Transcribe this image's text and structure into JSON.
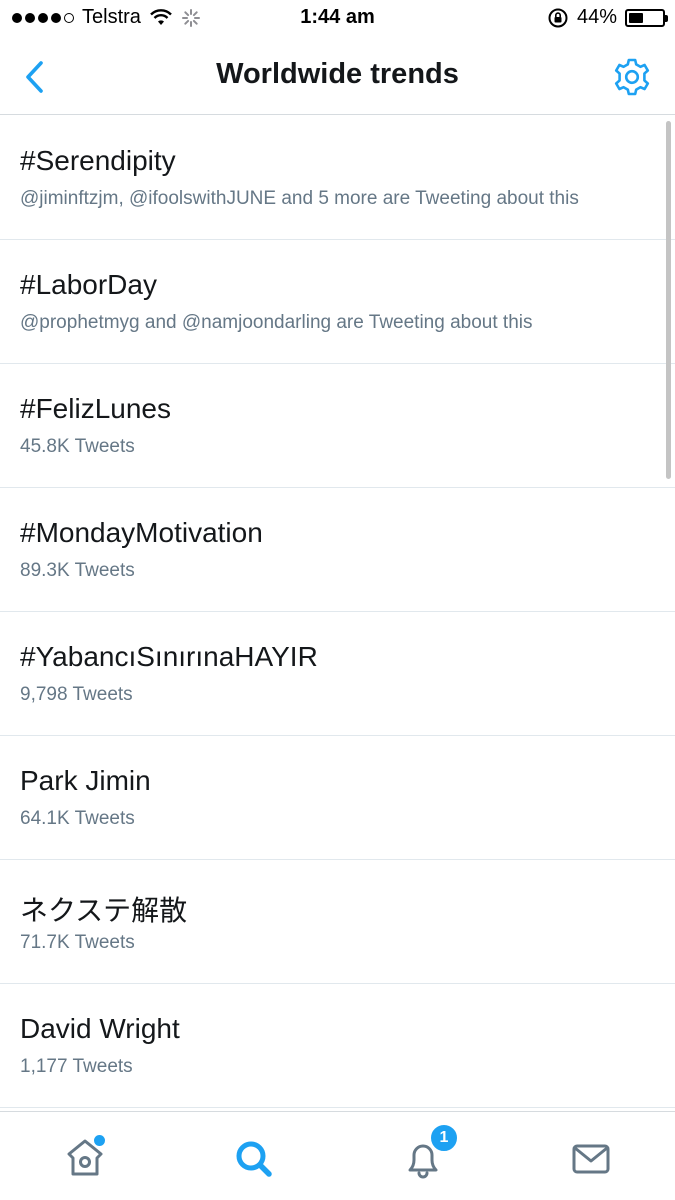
{
  "status_bar": {
    "carrier": "Telstra",
    "time": "1:44 am",
    "battery_percent": "44%",
    "battery_level": 0.44,
    "signal_dots_filled": 4,
    "signal_dots_total": 5
  },
  "nav": {
    "title": "Worldwide trends",
    "back_icon": "chevron-left-icon",
    "settings_icon": "gear-icon"
  },
  "trends": [
    {
      "name": "#Serendipity",
      "meta": "@jiminftzjm, @ifoolswithJUNE and 5 more are Tweeting about this"
    },
    {
      "name": "#LaborDay",
      "meta": "@prophetmyg and @namjoondarling are Tweeting about this"
    },
    {
      "name": "#FelizLunes",
      "meta": "45.8K Tweets"
    },
    {
      "name": "#MondayMotivation",
      "meta": "89.3K Tweets"
    },
    {
      "name": "#YabancıSınırınaHAYIR",
      "meta": "9,798 Tweets"
    },
    {
      "name": "Park Jimin",
      "meta": "64.1K Tweets"
    },
    {
      "name": "ネクステ解散",
      "meta": "71.7K Tweets"
    },
    {
      "name": "David Wright",
      "meta": "1,177 Tweets"
    }
  ],
  "tab_bar": {
    "tabs": [
      "home-icon",
      "search-icon",
      "notifications-icon",
      "messages-icon"
    ],
    "active_tab": "search-icon",
    "notification_count": "1"
  },
  "colors": {
    "accent": "#1da1f2",
    "primary_text": "#14171a",
    "secondary_text": "#657786",
    "icon_gray": "#657786",
    "divider": "#e1e8ed"
  }
}
